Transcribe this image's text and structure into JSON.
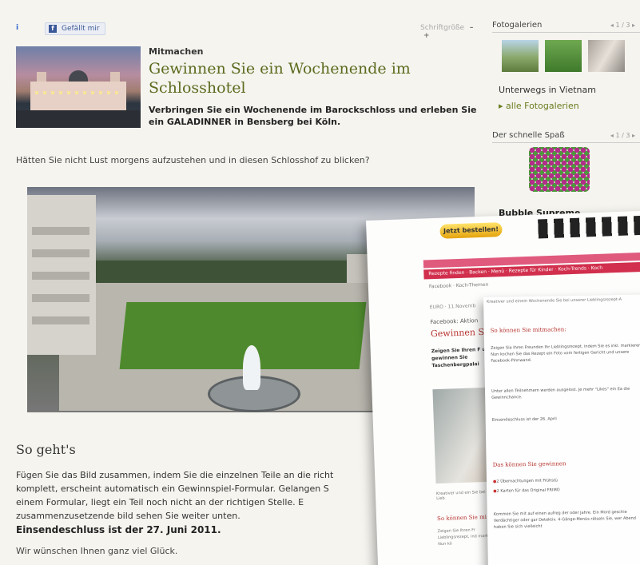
{
  "topbar": {
    "info_icon": "i",
    "like_label": "Gefällt mir",
    "font_size_label": "Schriftgröße",
    "font_minus": "–",
    "font_plus": "+"
  },
  "article": {
    "kicker": "Mitmachen",
    "headline": "Gewinnen Sie ein Wochenende im Schlosshotel",
    "intro": "Verbringen Sie ein Wochenende im Barockschloss und erleben Sie ein GALADINNER in Bensberg bei Köln.",
    "question": "Hätten Sie nicht Lust morgens aufzustehen und in diesen Schlosshof zu blicken?",
    "section_title": "So geht's",
    "body": "Fügen Sie das Bild zusammen, indem Sie die einzelnen Teile an die richt\nkomplett, erscheint automatisch ein Gewinnspiel-Formular. Gelangen S\neinem Formular, liegt ein Teil noch nicht an der richtigen Stelle. E\nzusammenzusetzende bild sehen Sie weiter unten.",
    "deadline": "Einsendeschluss ist der 27. Juni 2011.",
    "luck": "Wir wünschen Ihnen ganz viel Glück."
  },
  "sidebar": {
    "galleries_title": "Fotogalerien",
    "galleries_pager": "◂ 1 / 3 ▸",
    "gallery_caption": "Unterwegs in Vietnam",
    "all_galleries_link": "▸ alle Fotogalerien",
    "fun_title": "Der schnelle Spaß",
    "fun_pager": "◂ 1 / 3 ▸",
    "fun_caption": "Bubble Supreme"
  },
  "overlay_page": {
    "order_button": "Jetzt bestellen!",
    "nav": "Rezepte finden · Backen · Menü · Rezepte für Kinder · Koch-Trends · Koch",
    "crumb": "Facebook · Koch-Themen",
    "meta": "EURO · 11.Novemb",
    "facebook_label": "Facebook: Aktion",
    "headline": "Gewinnen S",
    "intro": "Zeigen Sie Ihren F und gewinnen Sie Taschenbergpalai",
    "caption": "Kreativer und ein Sie bei unserer Lieb",
    "subhead": "So können Sie mi",
    "small": "Zeigen Sie Ihren Fr Lieblingsrezept, ind markieren. Nun kö"
  },
  "overlay_detail": {
    "top_text": "Kreativer und einem Wochenende Sie bei unserer Lieblingsrezept-A",
    "section1_title": "So können Sie mitmachen:",
    "section1_text": "Zeigen Sie Ihren Freunden Ihr Lieblingsrezept, indem Sie es inkl. markieren. Nun kochen Sie das Rezept ein Foto vom fertigen Gericht und unsere Facebook-Pinnwand.",
    "section1_text2": "Unter allen Teilnehmern werden ausgelost. Je mehr \"Likes\" ein Ea die Gewinnchance.",
    "deadline": "Einsendeschluss ist der 26. April",
    "section2_title": "Das können Sie gewinnen",
    "bullet1": "2 Übernachtungen mit Frühstü",
    "bullet2": "2 Karten für das Original FRIMO",
    "section2_text": "Kommen Sie mit auf einen aufreg der oder Jahre. Ein Mord geschie Verdächtiger oder gar Detektiv. 4-Gänge-Menüs rätseln Sie, wer Abend haben Sie sich vielleicht"
  }
}
